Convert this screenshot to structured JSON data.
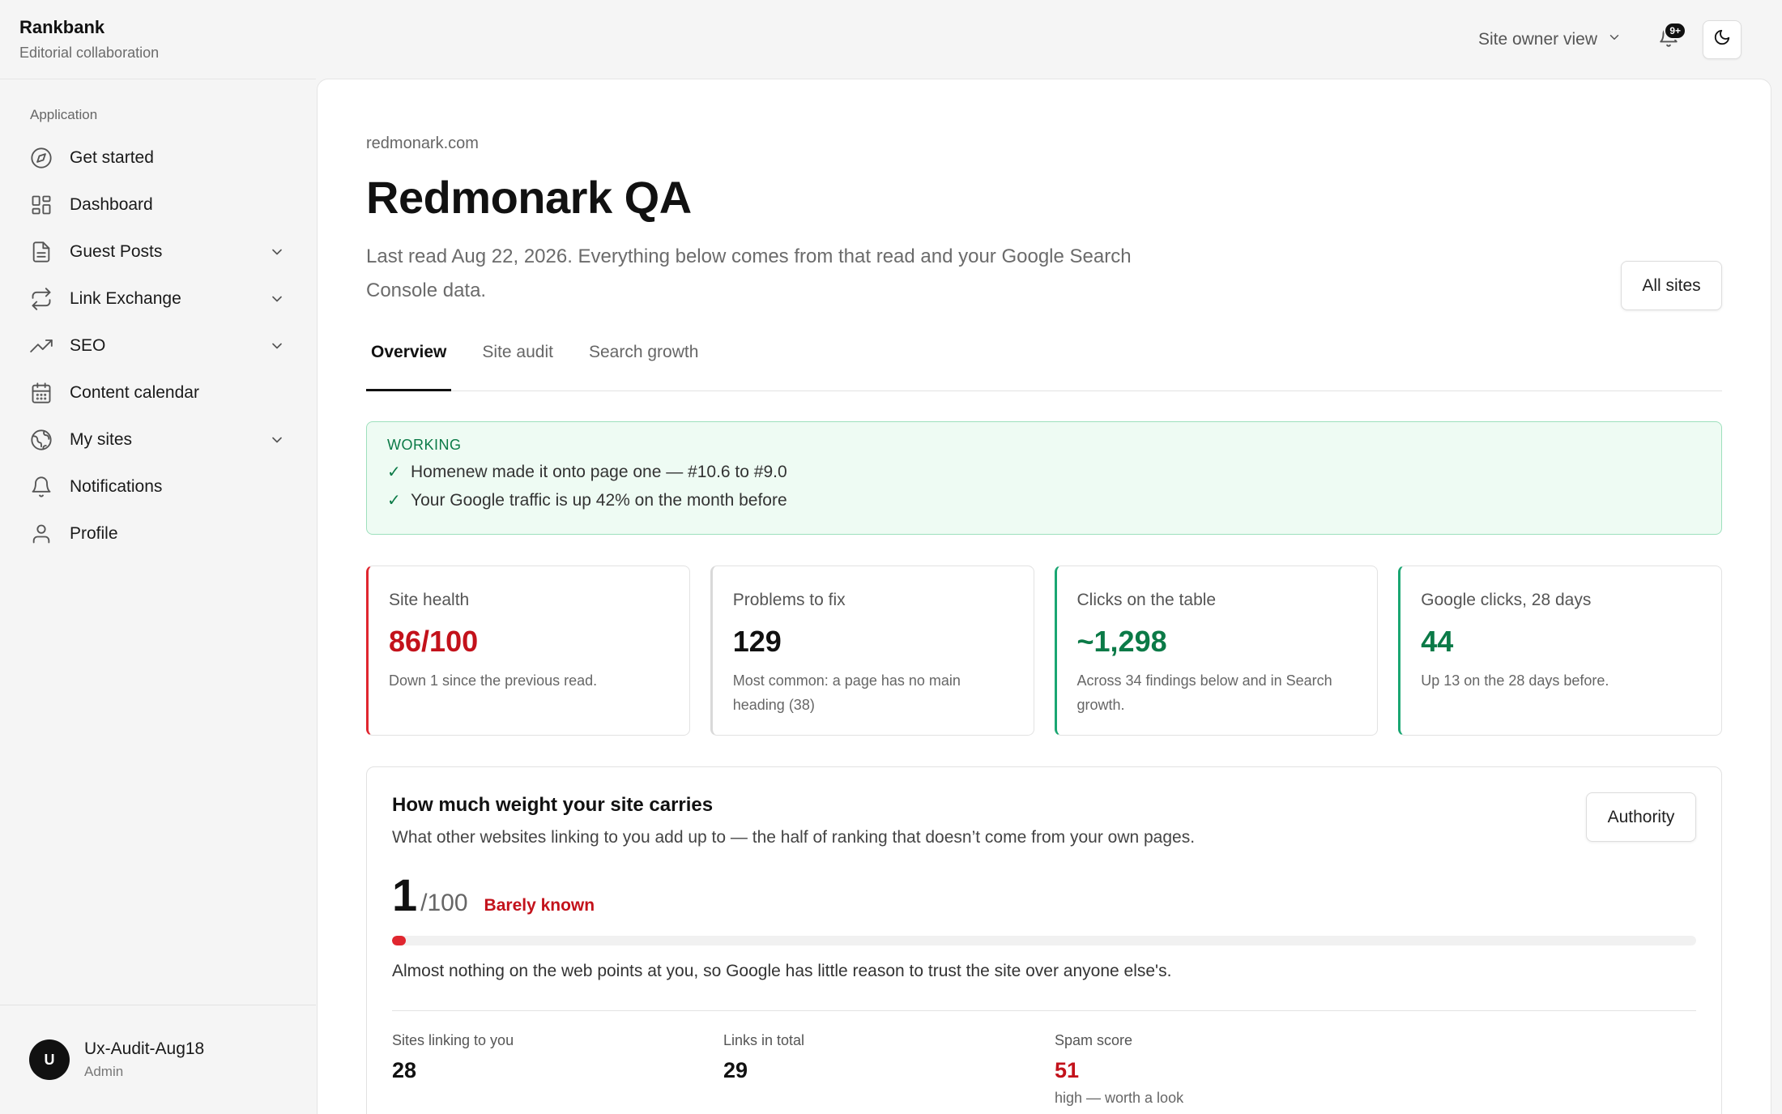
{
  "app": {
    "title": "Rankbank",
    "subtitle": "Editorial collaboration"
  },
  "topbar": {
    "view_label": "Site owner view",
    "badge": "9+"
  },
  "sidebar": {
    "group_label": "Application",
    "items": [
      {
        "label": "Get started",
        "icon": "compass-icon",
        "expandable": false
      },
      {
        "label": "Dashboard",
        "icon": "dashboard-icon",
        "expandable": false
      },
      {
        "label": "Guest Posts",
        "icon": "document-icon",
        "expandable": true
      },
      {
        "label": "Link Exchange",
        "icon": "exchange-icon",
        "expandable": true
      },
      {
        "label": "SEO",
        "icon": "trending-up-icon",
        "expandable": true
      },
      {
        "label": "Content calendar",
        "icon": "calendar-icon",
        "expandable": false
      },
      {
        "label": "My sites",
        "icon": "globe-icon",
        "expandable": true
      },
      {
        "label": "Notifications",
        "icon": "bell-icon",
        "expandable": false
      },
      {
        "label": "Profile",
        "icon": "user-icon",
        "expandable": false
      }
    ],
    "user": {
      "initial": "U",
      "name": "Ux-Audit-Aug18",
      "role": "Admin"
    }
  },
  "main": {
    "domain": "redmonark.com",
    "title": "Redmonark QA",
    "description": "Last read Aug 22, 2026. Everything below comes from that read and your Google Search Console data.",
    "all_sites_label": "All sites",
    "tabs": [
      "Overview",
      "Site audit",
      "Search growth"
    ],
    "active_tab": "Overview",
    "working": {
      "label": "WORKING",
      "items": [
        "Homenew made it onto page one — #10.6 to #9.0",
        "Your Google traffic is up 42% on the month before"
      ]
    },
    "stats": [
      {
        "label": "Site health",
        "value": "86/100",
        "sub": "Down 1 since the previous read.",
        "value_color": "#c3121b",
        "accent": "#e0262f"
      },
      {
        "label": "Problems to fix",
        "value": "129",
        "sub": "Most common: a page has no main heading (38)",
        "value_color": "#111111",
        "accent": "#d9d9d9"
      },
      {
        "label": "Clicks on the table",
        "value": "~1,298",
        "sub": "Across 34 findings below and in Search growth.",
        "value_color": "#0b7a47",
        "accent": "#1aa672"
      },
      {
        "label": "Google clicks, 28 days",
        "value": "44",
        "sub": "Up 13 on the 28 days before.",
        "value_color": "#0b7a47",
        "accent": "#1aa672"
      }
    ],
    "weight": {
      "title": "How much weight your site carries",
      "description": "What other websites linking to you add up to — the half of ranking that doesn’t come from your own pages.",
      "authority_label": "Authority",
      "score": "1",
      "score_max": "/100",
      "score_fraction": 0.01,
      "score_tag": "Barely known",
      "note": "Almost nothing on the web points at you, so Google has little reason to trust the site over anyone else's.",
      "metrics": [
        {
          "label": "Sites linking to you",
          "value": "28",
          "sub": "",
          "color": "#111111"
        },
        {
          "label": "Links in total",
          "value": "29",
          "sub": "",
          "color": "#111111"
        },
        {
          "label": "Spam score",
          "value": "51",
          "sub": "high — worth a look",
          "color": "#c3121b"
        }
      ]
    }
  }
}
